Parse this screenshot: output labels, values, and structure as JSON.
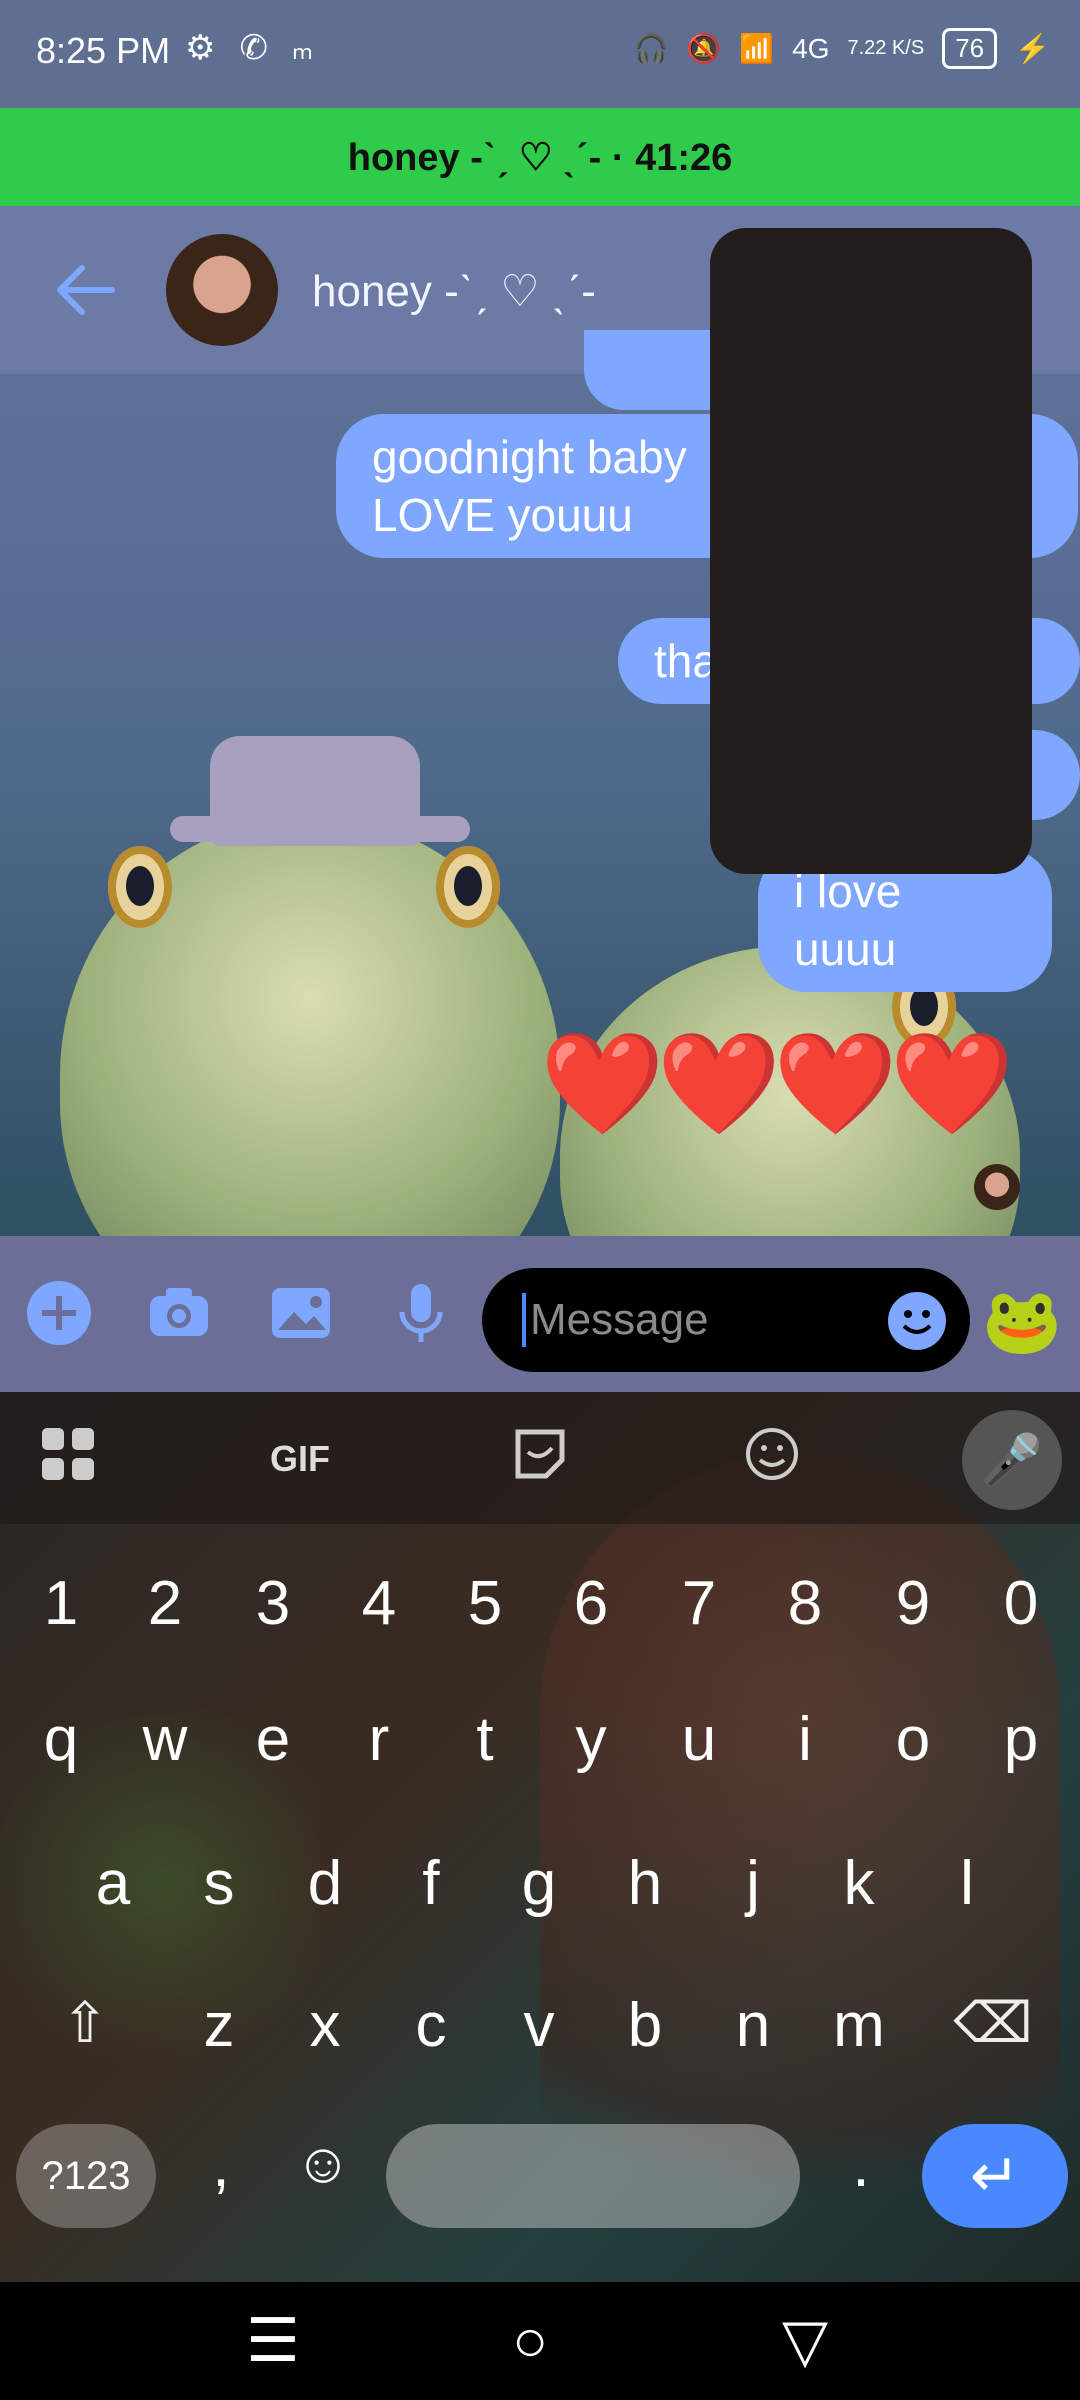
{
  "status_bar": {
    "time": "8:25 PM",
    "icons_left": [
      "gear-icon",
      "phone-icon",
      "m-icon"
    ],
    "network": "4G",
    "speed": "7.22 K/S",
    "battery": "76"
  },
  "call_banner": {
    "text": "honey -ˋˏ ♡ ˎˊ- · 41:26"
  },
  "header": {
    "contact_name": "honey -ˋˏ ♡ ˎˊ-"
  },
  "messages": [
    {
      "text": "goodnight baby\nLOVE youuu",
      "sender": "me"
    },
    {
      "text": "tha",
      "sender": "me"
    },
    {
      "text": "i love uuuu",
      "sender": "me"
    },
    {
      "text": "❤️❤️❤️❤️",
      "sender": "me"
    }
  ],
  "composer": {
    "placeholder": "Message"
  },
  "keyboard": {
    "toolbar": [
      "apps-icon",
      "GIF",
      "sticker-icon",
      "emoji-icon",
      "mic-icon"
    ],
    "row_numbers": [
      "1",
      "2",
      "3",
      "4",
      "5",
      "6",
      "7",
      "8",
      "9",
      "0"
    ],
    "row1": [
      "q",
      "w",
      "e",
      "r",
      "t",
      "y",
      "u",
      "i",
      "o",
      "p"
    ],
    "row2": [
      "a",
      "s",
      "d",
      "f",
      "g",
      "h",
      "j",
      "k",
      "l"
    ],
    "row3": [
      "z",
      "x",
      "c",
      "v",
      "b",
      "n",
      "m"
    ],
    "sym_label": "?123",
    "comma": ",",
    "period": "."
  },
  "colors": {
    "bubble": "#7fa7ff",
    "call_banner": "#2ecc4a",
    "accent": "#4a88ff"
  }
}
